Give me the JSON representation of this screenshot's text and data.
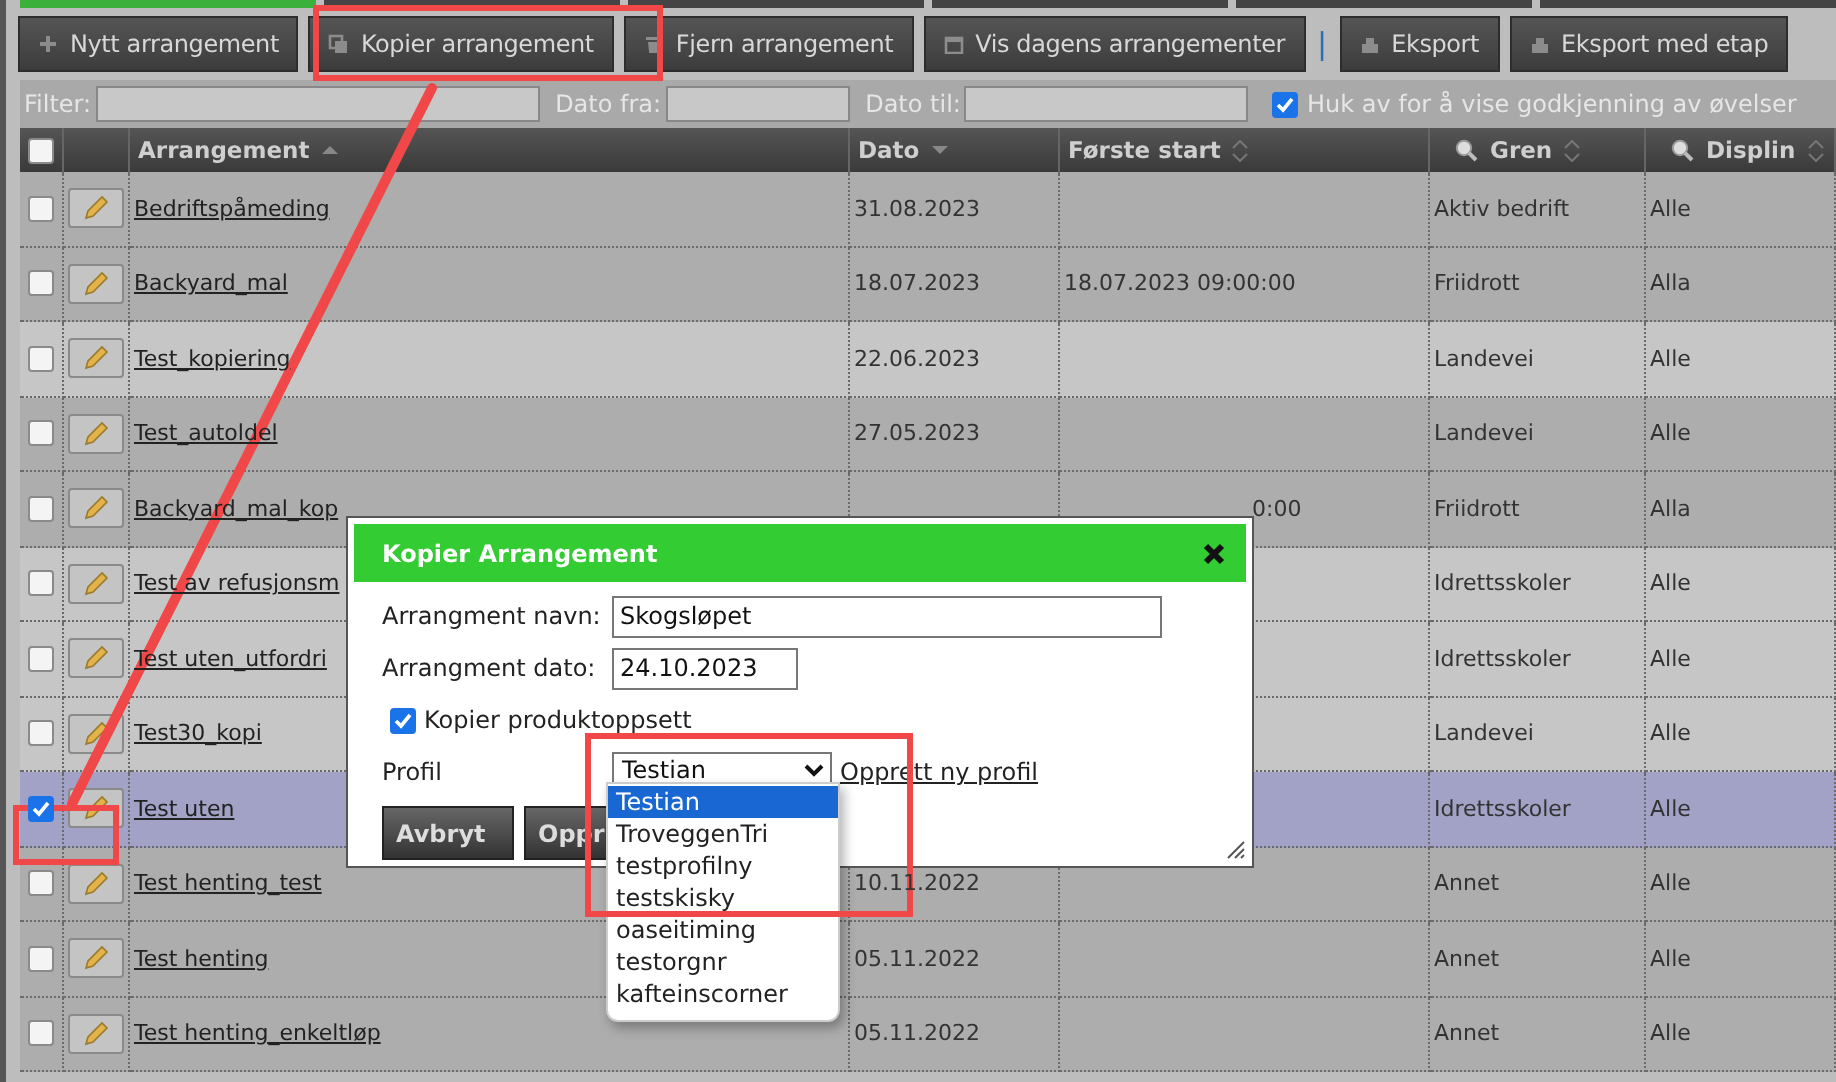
{
  "tabs": [
    {
      "selected": true
    },
    {
      "selected": false
    },
    {
      "selected": false
    },
    {
      "selected": false
    },
    {
      "selected": false
    },
    {
      "selected": false
    }
  ],
  "toolbar": {
    "buttons": [
      {
        "label": "Nytt arrangement"
      },
      {
        "label": "Kopier arrangement"
      },
      {
        "label": "Fjern arrangement"
      },
      {
        "label": "Vis dagens arrangementer"
      },
      {
        "label": "Eksport"
      },
      {
        "label": "Eksport med etap"
      }
    ],
    "separator": "|"
  },
  "filters": {
    "filter_label": "Filter:",
    "date_from_label": "Dato fra:",
    "date_to_label": "Dato til:",
    "approval": {
      "label": "Huk av for å vise godkjenning av øvelser",
      "checked": true
    }
  },
  "table": {
    "select_all_checked": false,
    "columns": [
      {
        "label": "Arrangement",
        "sort_asc": true,
        "sort_desc": false,
        "searchable": false
      },
      {
        "label": "Dato",
        "sort_asc": false,
        "sort_desc": true,
        "searchable": false
      },
      {
        "label": "Første start",
        "sort_asc": false,
        "sort_desc": false,
        "searchable": false
      },
      {
        "label": "Gren",
        "sort_asc": false,
        "sort_desc": false,
        "searchable": true
      },
      {
        "label": "Displin",
        "sort_asc": false,
        "sort_desc": false,
        "searchable": true
      }
    ],
    "rows": [
      {
        "highlighted": false,
        "checked": false,
        "selected": false,
        "name": "Bedriftspåmeding",
        "date": "31.08.2023",
        "gren": "Aktiv bedrift",
        "displin": "Alle"
      },
      {
        "highlighted": false,
        "checked": false,
        "selected": false,
        "name": "Backyard_mal",
        "date": "18.07.2023",
        "first_start": "18.07.2023 09:00:00",
        "gren": "Friidrott",
        "displin": "Alla"
      },
      {
        "highlighted": true,
        "checked": false,
        "selected": false,
        "name": "Test_kopiering",
        "date": "22.06.2023",
        "gren": "Landevei",
        "displin": "Alle"
      },
      {
        "highlighted": false,
        "checked": false,
        "selected": false,
        "name": "Test_autoldel",
        "date": "27.05.2023",
        "gren": "Landevei",
        "displin": "Alle"
      },
      {
        "highlighted": false,
        "checked": false,
        "selected": false,
        "name": "Backyard_mal_kop",
        "first_start_tail": "0:00",
        "gren": "Friidrott",
        "displin": "Alla"
      },
      {
        "highlighted": true,
        "checked": false,
        "selected": false,
        "name": "Test av refusjonsm",
        "gren": "Idrettsskoler",
        "displin": "Alle"
      },
      {
        "highlighted": true,
        "checked": false,
        "selected": false,
        "name": "Test uten_utfordri",
        "gren": "Idrettsskoler",
        "displin": "Alle"
      },
      {
        "highlighted": true,
        "checked": false,
        "selected": false,
        "name": "Test30_kopi",
        "gren": "Landevei",
        "displin": "Alle"
      },
      {
        "checked": true,
        "selected": true,
        "name": "Test uten",
        "gren": "Idrettsskoler",
        "displin": "Alle"
      },
      {
        "highlighted": false,
        "checked": false,
        "selected": false,
        "name": "Test henting_test",
        "date": "10.11.2022",
        "gren": "Annet",
        "displin": "Alle"
      },
      {
        "highlighted": false,
        "checked": false,
        "selected": false,
        "name": "Test henting",
        "date": "05.11.2022",
        "gren": "Annet",
        "displin": "Alle"
      },
      {
        "highlighted": false,
        "checked": false,
        "selected": false,
        "name": "Test henting_enkeltløp",
        "date": "05.11.2022",
        "gren": "Annet",
        "displin": "Alle"
      }
    ]
  },
  "dialog": {
    "title": "Kopier Arrangement",
    "name_label": "Arrangment navn:",
    "name_value": "Skogsløpet",
    "date_label": "Arrangment dato:",
    "date_value": "24.10.2023",
    "copy_products": {
      "label": "Kopier produktoppsett",
      "checked": true
    },
    "profile_label": "Profil",
    "profile_value": "Testian",
    "create_profile_link": "Opprett ny profil",
    "buttons": [
      "Avbryt",
      "Oppr"
    ],
    "profile_options": [
      {
        "label": "Testian",
        "selected": true
      },
      {
        "label": "TroveggenTri",
        "selected": false
      },
      {
        "label": "testprofilny",
        "selected": false
      },
      {
        "label": "testskisky",
        "selected": false
      },
      {
        "label": "oaseitiming",
        "selected": false
      },
      {
        "label": "testorgnr",
        "selected": false
      },
      {
        "label": "kafteinscorner",
        "selected": false
      }
    ]
  }
}
